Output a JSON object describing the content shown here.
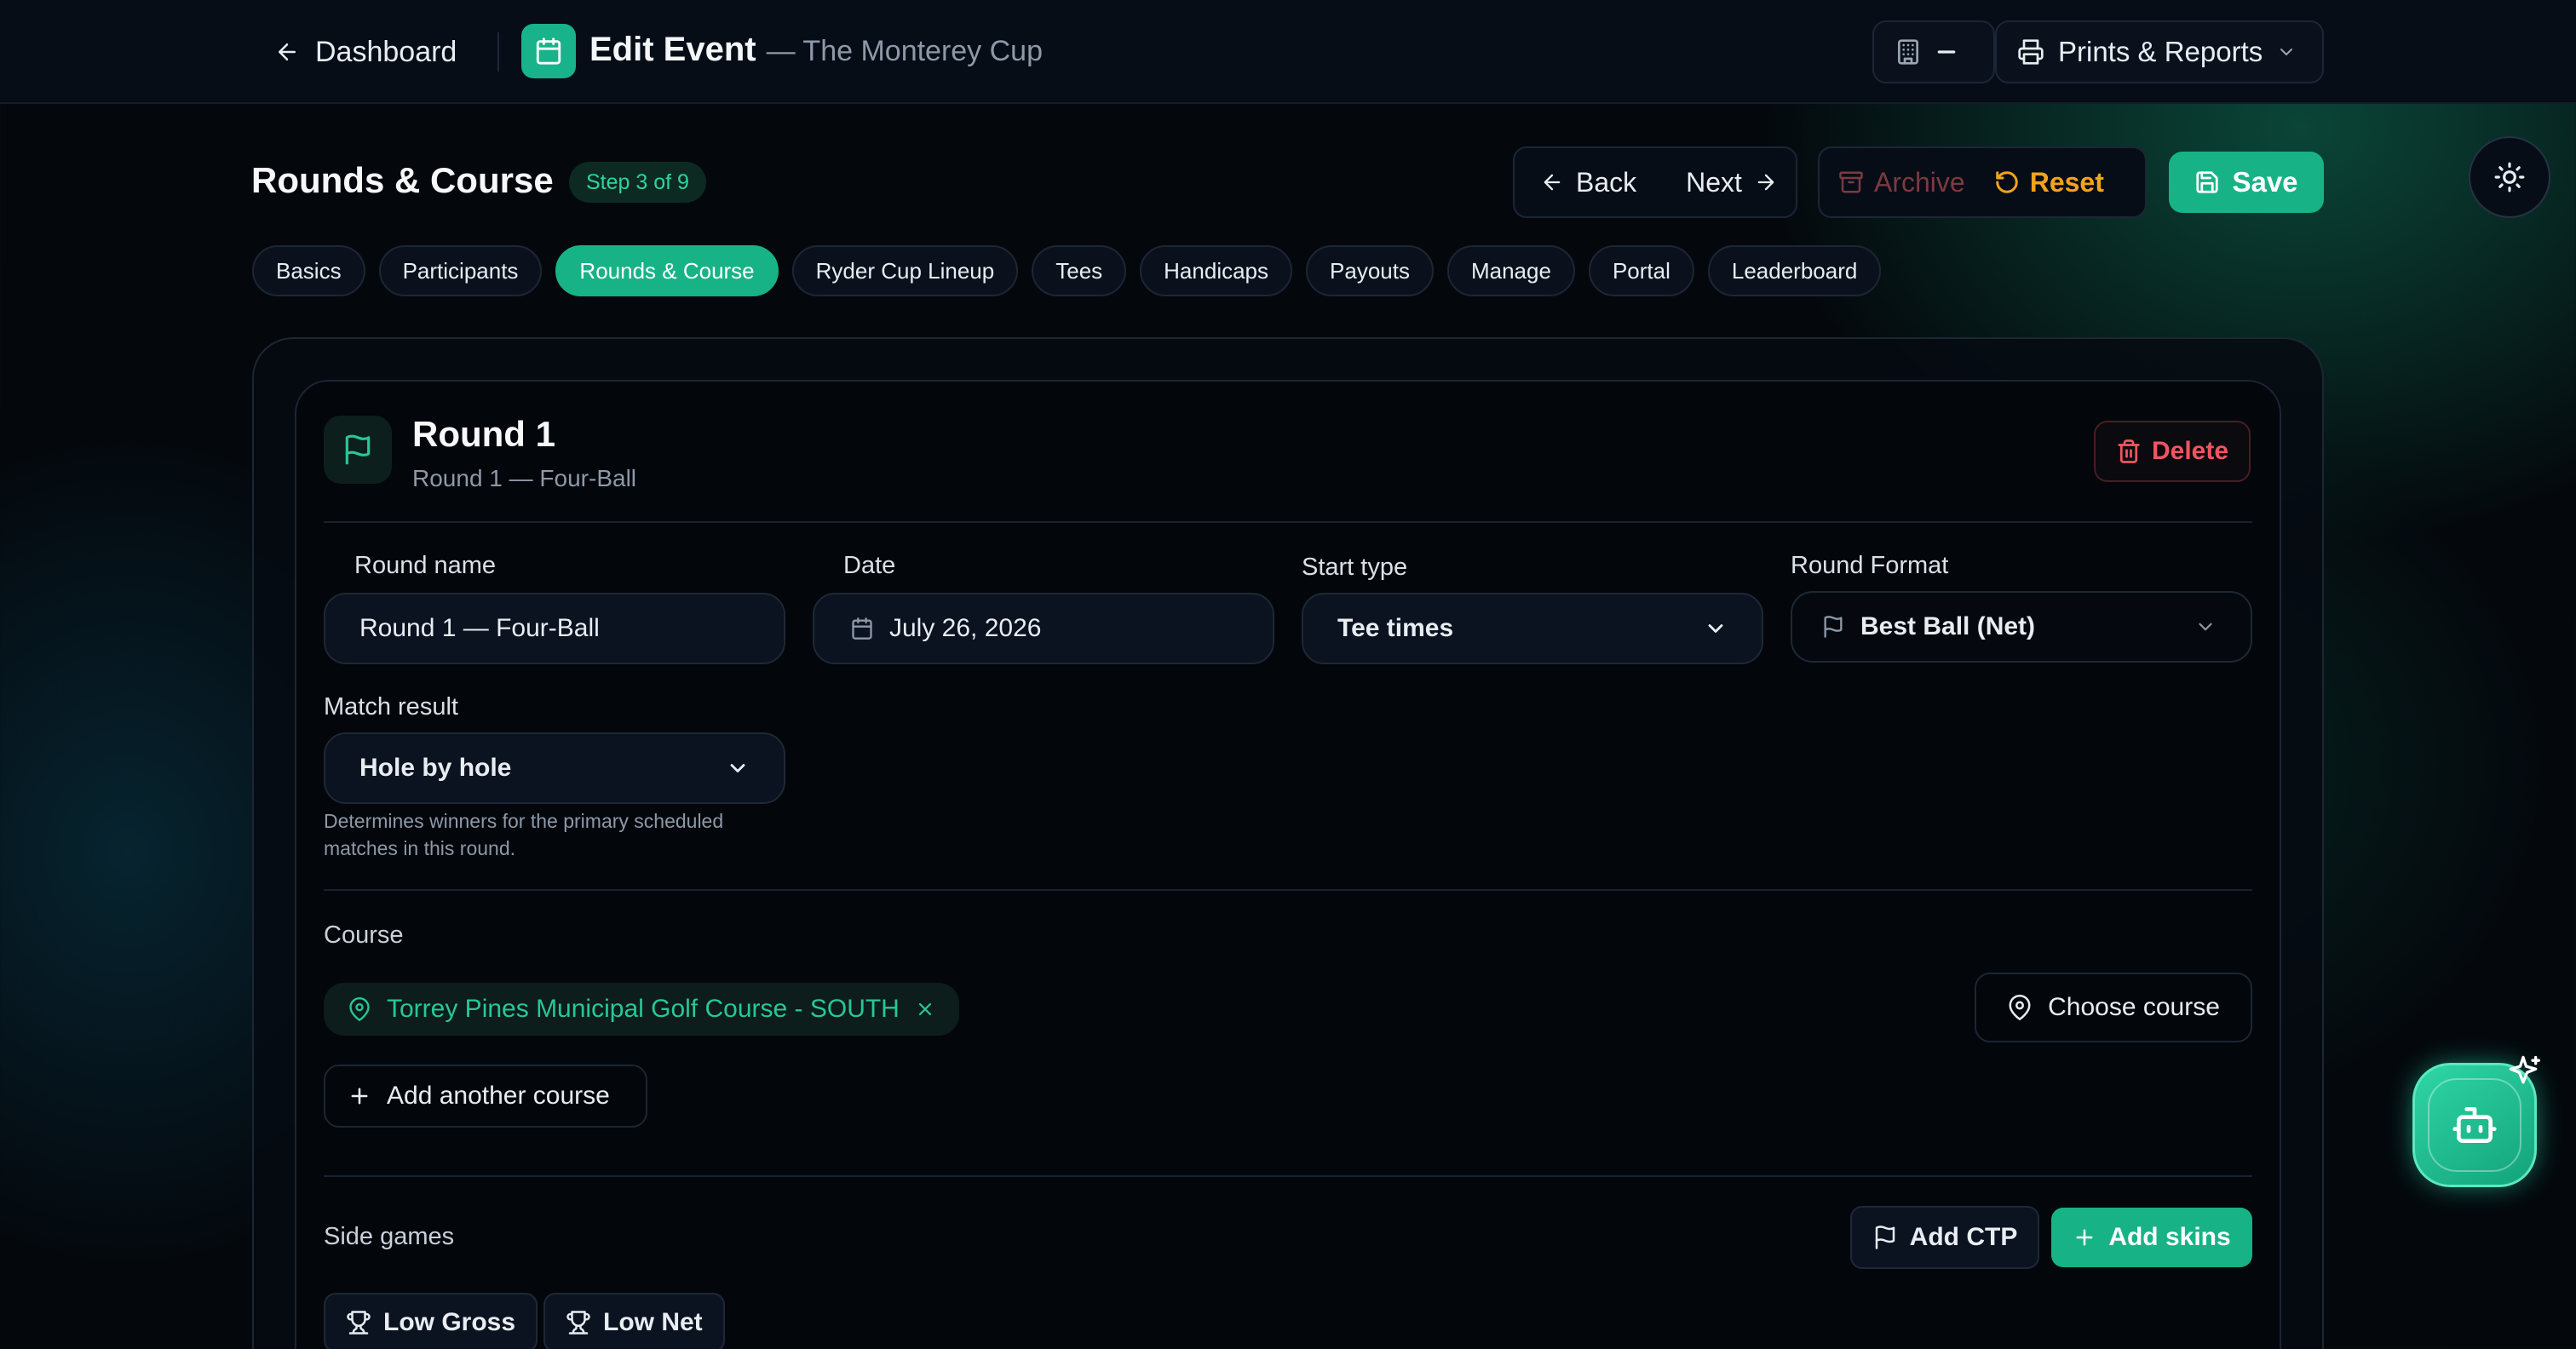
{
  "topbar": {
    "back_label": "Dashboard",
    "event_title": "Edit Event",
    "event_subtitle": "— The Monterey Cup",
    "prints_label": "Prints & Reports"
  },
  "header": {
    "title": "Rounds & Course",
    "step": "Step 3 of 9",
    "back_label": "Back",
    "next_label": "Next",
    "archive_label": "Archive",
    "reset_label": "Reset",
    "save_label": "Save"
  },
  "tabs": [
    {
      "label": "Basics",
      "active": false
    },
    {
      "label": "Participants",
      "active": false
    },
    {
      "label": "Rounds & Course",
      "active": true
    },
    {
      "label": "Ryder Cup Lineup",
      "active": false
    },
    {
      "label": "Tees",
      "active": false
    },
    {
      "label": "Handicaps",
      "active": false
    },
    {
      "label": "Payouts",
      "active": false
    },
    {
      "label": "Manage",
      "active": false
    },
    {
      "label": "Portal",
      "active": false
    },
    {
      "label": "Leaderboard",
      "active": false
    }
  ],
  "round": {
    "title": "Round 1",
    "subtitle": "Round 1 — Four-Ball",
    "delete_label": "Delete",
    "fields": {
      "round_name_label": "Round name",
      "round_name_value": "Round 1 — Four-Ball",
      "date_label": "Date",
      "date_value": "July 26, 2026",
      "start_type_label": "Start type",
      "start_type_value": "Tee times",
      "round_format_label": "Round Format",
      "round_format_value": "Best Ball (Net)",
      "match_result_label": "Match result",
      "match_result_value": "Hole by hole",
      "match_result_help": "Determines winners for the primary scheduled matches in this round."
    },
    "course": {
      "label": "Course",
      "selected": "Torrey Pines Municipal Golf Course - SOUTH",
      "choose_label": "Choose course",
      "add_label": "Add another course"
    },
    "side_games": {
      "label": "Side games",
      "add_ctp_label": "Add CTP",
      "add_skins_label": "Add skins",
      "items": [
        "Low Gross",
        "Low Net"
      ]
    }
  },
  "colors": {
    "accent": "#17b386",
    "background": "#04080d",
    "danger": "#f05560",
    "warning": "#f3a31c"
  },
  "icons": [
    "arrow-left-icon",
    "calendar-icon",
    "building-icon",
    "minus-icon",
    "printer-icon",
    "chevron-down-icon",
    "arrow-right-icon",
    "archive-icon",
    "reset-icon",
    "save-icon",
    "sun-icon",
    "flag-icon",
    "trash-icon",
    "map-pin-icon",
    "close-icon",
    "plus-icon",
    "trophy-icon",
    "robot-icon",
    "sparkle-icon"
  ]
}
